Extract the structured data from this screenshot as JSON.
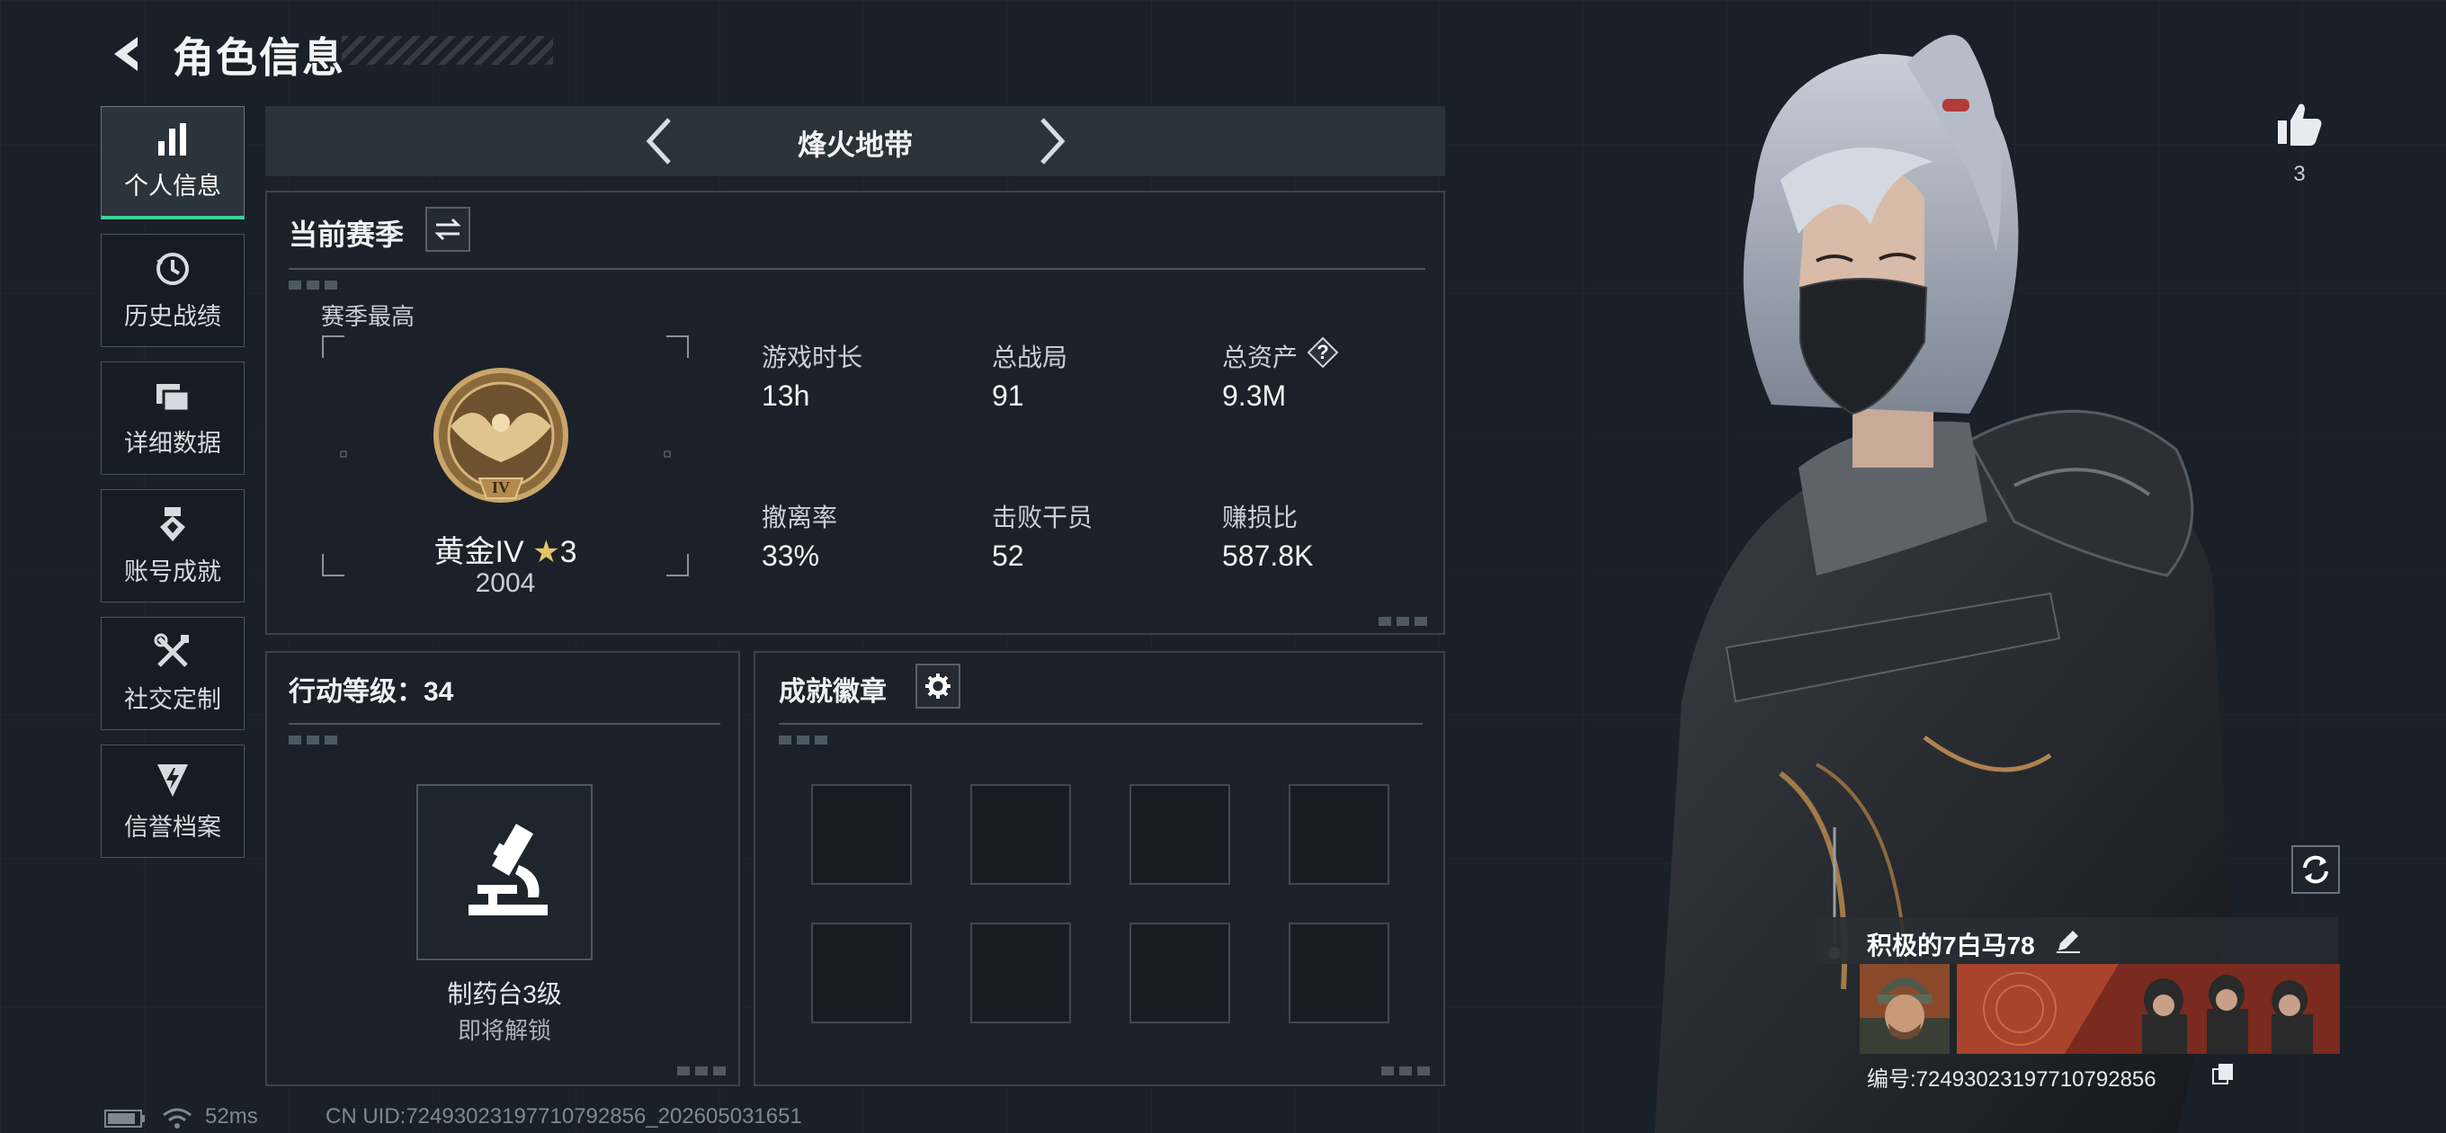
{
  "header": {
    "title": "角色信息"
  },
  "sidebar": {
    "items": [
      {
        "label": "个人信息",
        "icon": "bar-chart-icon",
        "active": true
      },
      {
        "label": "历史战绩",
        "icon": "history-clock-icon"
      },
      {
        "label": "详细数据",
        "icon": "folder-icon"
      },
      {
        "label": "账号成就",
        "icon": "achievement-medal-icon"
      },
      {
        "label": "社交定制",
        "icon": "tools-icon"
      },
      {
        "label": "信誉档案",
        "icon": "shield-bolt-icon"
      }
    ]
  },
  "mode_selector": {
    "label": "烽火地带"
  },
  "season": {
    "title": "当前赛季",
    "best_label": "赛季最高",
    "rank_name": "黄金IV",
    "rank_stars": "3",
    "rank_score": "2004",
    "rank_badge_numeral": "IV",
    "stats": [
      {
        "label": "游戏时长",
        "value": "13h"
      },
      {
        "label": "总战局",
        "value": "91"
      },
      {
        "label": "总资产",
        "value": "9.3M",
        "help": "?"
      },
      {
        "label": "撤离率",
        "value": "33%"
      },
      {
        "label": "击败干员",
        "value": "52"
      },
      {
        "label": "赚损比",
        "value": "587.8K"
      }
    ]
  },
  "action_level": {
    "title": "行动等级：34",
    "item_name": "制药台3级",
    "item_status": "即将解锁"
  },
  "badges": {
    "title": "成就徽章",
    "slots": 8
  },
  "likes": {
    "count": "3"
  },
  "player": {
    "name": "积极的7白马78",
    "id_text": "编号:72493023197710792856"
  },
  "status_bar": {
    "ping": "52ms",
    "uid": "CN UID:72493023197710792856_202605031651"
  },
  "colors": {
    "accent": "#3cd39a",
    "background": "#1a2028",
    "panel": "#1c2229"
  }
}
